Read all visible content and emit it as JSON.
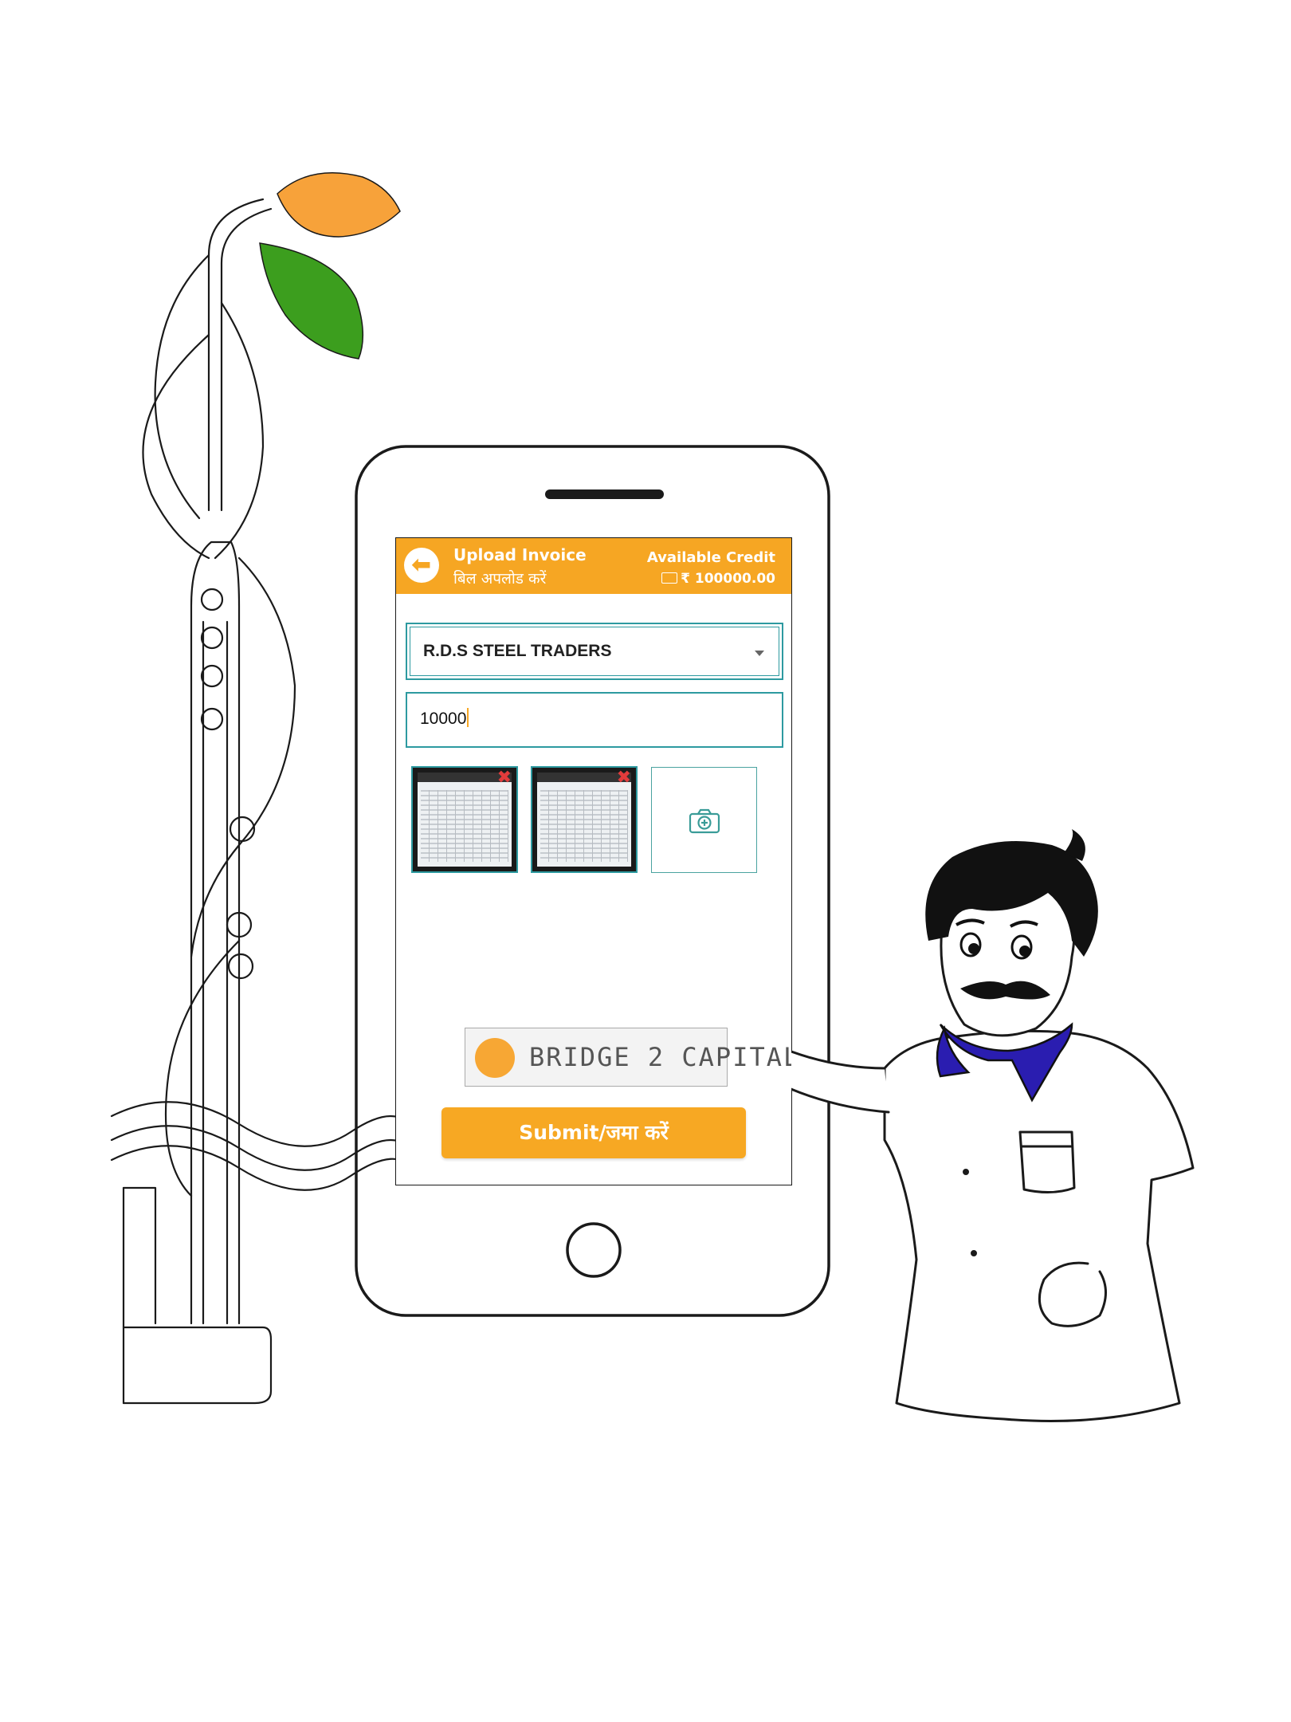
{
  "header": {
    "title": "Upload Invoice",
    "title_hindi": "बिल अपलोड करें",
    "credit_label": "Available Credit",
    "credit_amount": "₹ 100000.00"
  },
  "form": {
    "seller_selected": "R.D.S STEEL TRADERS",
    "amount_value": "10000"
  },
  "attachments": {
    "count": 2,
    "remove_symbol": "✖"
  },
  "brand": {
    "logo_text": "BRIDGE 2 CAPITAL"
  },
  "submit_label": "Submit/जमा करें",
  "icons": {
    "back": "arrow-left-icon",
    "wallet": "wallet-icon",
    "dropdown": "chevron-down-icon",
    "remove": "close-icon",
    "camera": "camera-add-icon"
  },
  "colors": {
    "primary": "#F6A623",
    "accent": "#2D9AA0",
    "leaf_orange": "#F7A23A",
    "leaf_green": "#3C9E1E",
    "collar_blue": "#2A1DB0",
    "remove_red": "#E23B3B"
  }
}
